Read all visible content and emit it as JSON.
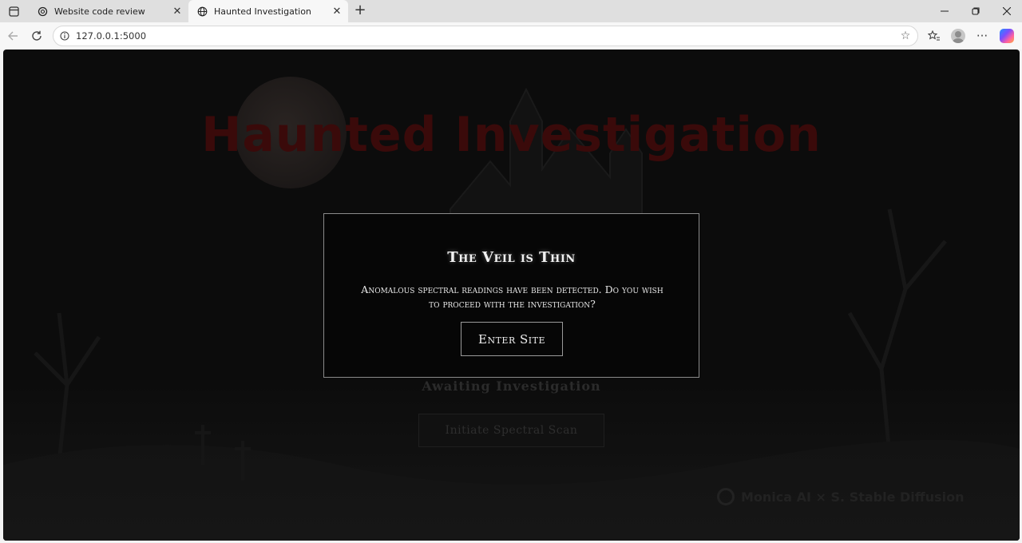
{
  "browser": {
    "tabs": [
      {
        "title": "Website code review",
        "favicon": "openai-icon",
        "active": false
      },
      {
        "title": "Haunted Investigation",
        "favicon": "globe-icon",
        "active": true
      }
    ],
    "url": "127.0.0.1:5000"
  },
  "page": {
    "title": "Haunted Investigation",
    "status": "Awaiting Investigation",
    "scan_button": "Initiate Spectral Scan",
    "watermark": "Monica AI × S. Stable Diffusion"
  },
  "modal": {
    "title": "The Veil is Thin",
    "message": "Anomalous spectral readings have been detected. Do you wish to proceed with the investigation?",
    "enter_button": "Enter Site"
  },
  "colors": {
    "background": "#0c0c0c",
    "title_red": "#3a0a0a",
    "modal_border": "#8a8a8a"
  }
}
